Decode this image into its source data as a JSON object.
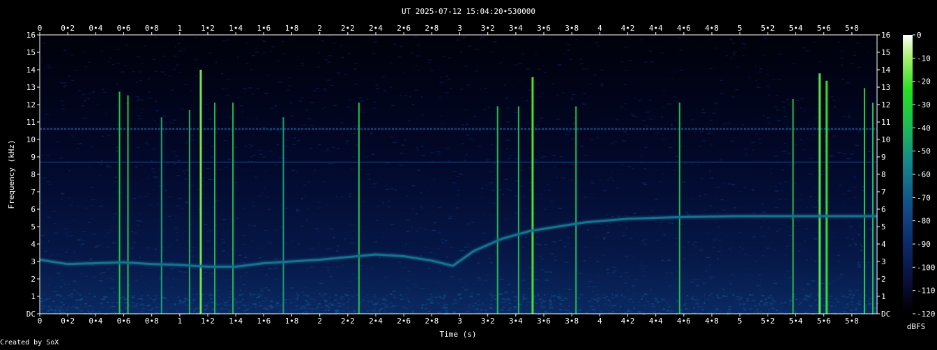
{
  "header": {
    "title": "UT 2025-07-12 15:04:20•530000"
  },
  "footer": {
    "credit": "Created by SoX"
  },
  "chart_data": {
    "type": "heatmap",
    "title": "UT 2025-07-12 15:04:20•530000",
    "xlabel": "Time (s)",
    "ylabel": "Frequency (kHz)",
    "xlim": [
      0,
      5.98
    ],
    "ylim": [
      0,
      16
    ],
    "x_ticks": [
      "0",
      "0•2",
      "0•4",
      "0•6",
      "0•8",
      "1",
      "1•2",
      "1•4",
      "1•6",
      "1•8",
      "2",
      "2•2",
      "2•4",
      "2•6",
      "2•8",
      "3",
      "3•2",
      "3•4",
      "3•6",
      "3•8",
      "4",
      "4•2",
      "4•4",
      "4•6",
      "4•8",
      "5",
      "5•2",
      "5•4",
      "5•6",
      "5•8"
    ],
    "y_ticks": [
      "DC",
      "1",
      "2",
      "3",
      "4",
      "5",
      "6",
      "7",
      "8",
      "9",
      "10",
      "11",
      "12",
      "13",
      "14",
      "15",
      "16"
    ],
    "colorbar": {
      "label": "dBFS",
      "ticks": [
        "0",
        "-10",
        "-20",
        "-30",
        "-40",
        "-50",
        "-60",
        "-70",
        "-80",
        "-90",
        "-100",
        "-110",
        "-120"
      ],
      "range": [
        -120,
        0
      ]
    },
    "colormap": [
      "#000000",
      "#0a0f3a",
      "#0c2a6a",
      "#12528a",
      "#168a8a",
      "#1cbf50",
      "#25e020",
      "#a8f070",
      "#ffffff"
    ],
    "grid": false,
    "features": {
      "tone_track": [
        {
          "t": 0.0,
          "f": 3.1
        },
        {
          "t": 0.2,
          "f": 2.85
        },
        {
          "t": 0.4,
          "f": 2.9
        },
        {
          "t": 0.6,
          "f": 2.95
        },
        {
          "t": 0.8,
          "f": 2.85
        },
        {
          "t": 1.0,
          "f": 2.8
        },
        {
          "t": 1.2,
          "f": 2.7
        },
        {
          "t": 1.4,
          "f": 2.7
        },
        {
          "t": 1.6,
          "f": 2.9
        },
        {
          "t": 1.8,
          "f": 3.0
        },
        {
          "t": 2.0,
          "f": 3.1
        },
        {
          "t": 2.2,
          "f": 3.25
        },
        {
          "t": 2.4,
          "f": 3.4
        },
        {
          "t": 2.6,
          "f": 3.3
        },
        {
          "t": 2.8,
          "f": 3.05
        },
        {
          "t": 2.95,
          "f": 2.75
        },
        {
          "t": 3.1,
          "f": 3.6
        },
        {
          "t": 3.3,
          "f": 4.3
        },
        {
          "t": 3.5,
          "f": 4.75
        },
        {
          "t": 3.7,
          "f": 5.0
        },
        {
          "t": 3.9,
          "f": 5.25
        },
        {
          "t": 4.2,
          "f": 5.45
        },
        {
          "t": 4.6,
          "f": 5.55
        },
        {
          "t": 5.0,
          "f": 5.6
        },
        {
          "t": 5.5,
          "f": 5.6
        },
        {
          "t": 5.98,
          "f": 5.6
        }
      ],
      "horizontal_lines_khz": [
        10.6,
        8.7
      ],
      "broadband_clicks": [
        {
          "t": 0.57,
          "level": 0.7
        },
        {
          "t": 0.63,
          "level": 0.65
        },
        {
          "t": 0.87,
          "level": 0.35
        },
        {
          "t": 1.07,
          "level": 0.45
        },
        {
          "t": 1.15,
          "level": 1.0
        },
        {
          "t": 1.25,
          "level": 0.55
        },
        {
          "t": 1.38,
          "level": 0.55
        },
        {
          "t": 1.74,
          "level": 0.35
        },
        {
          "t": 2.28,
          "level": 0.55
        },
        {
          "t": 3.27,
          "level": 0.5
        },
        {
          "t": 3.42,
          "level": 0.5
        },
        {
          "t": 3.52,
          "level": 0.9
        },
        {
          "t": 3.83,
          "level": 0.5
        },
        {
          "t": 4.57,
          "level": 0.55
        },
        {
          "t": 5.38,
          "level": 0.6
        },
        {
          "t": 5.57,
          "level": 0.95
        },
        {
          "t": 5.62,
          "level": 0.85
        },
        {
          "t": 5.89,
          "level": 0.75
        },
        {
          "t": 5.95,
          "level": 0.55
        }
      ]
    }
  }
}
